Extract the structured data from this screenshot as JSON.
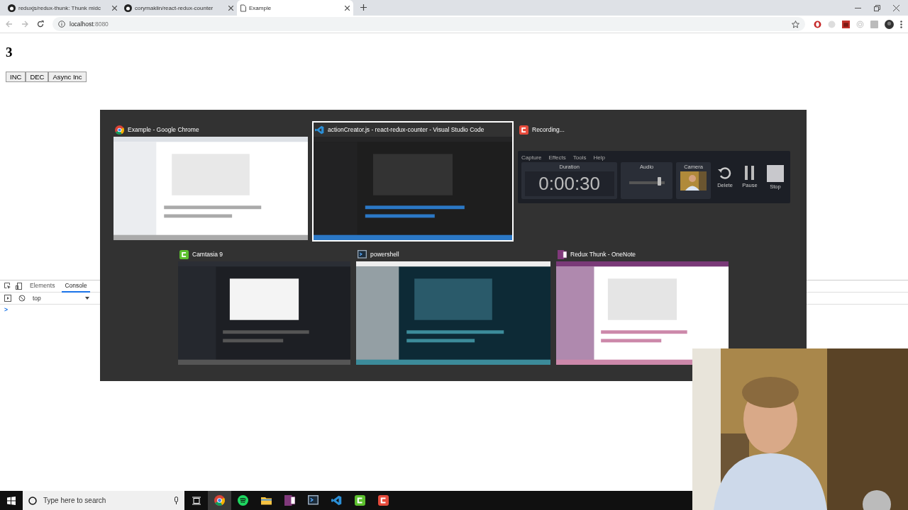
{
  "browser": {
    "tabs": [
      {
        "title": "reduxjs/redux-thunk: Thunk midc",
        "kind": "github",
        "selected": false
      },
      {
        "title": "corymaklin/react-redux-counter",
        "kind": "github",
        "selected": false
      },
      {
        "title": "Example",
        "kind": "page",
        "selected": true
      }
    ],
    "address": {
      "host": "localhost",
      "port": ":8080"
    }
  },
  "page": {
    "heading": "3",
    "buttons": [
      "INC",
      "DEC",
      "Async Inc"
    ]
  },
  "devtools": {
    "tabs": [
      {
        "label": "Elements",
        "selected": false
      },
      {
        "label": "Console",
        "selected": true
      }
    ],
    "context": "top",
    "prompt": ">"
  },
  "switcher": {
    "rows": [
      [
        {
          "title": "Example - Google Chrome",
          "kind": "chrome",
          "selected": false
        },
        {
          "title": "actionCreator.js - react-redux-counter - Visual Studio Code",
          "kind": "vscode",
          "selected": true
        },
        {
          "title": "Recording...",
          "kind": "recorder",
          "selected": false
        }
      ],
      [
        {
          "title": "Camtasia 9",
          "kind": "camtasia",
          "selected": false
        },
        {
          "title": "powershell",
          "kind": "powershell",
          "selected": false
        },
        {
          "title": "Redux Thunk - OneNote",
          "kind": "onenote",
          "selected": false
        }
      ]
    ],
    "recorder": {
      "menu": [
        "Capture",
        "Effects",
        "Tools",
        "Help"
      ],
      "duration_label": "Duration",
      "duration": "0:00:30",
      "audio_label": "Audio",
      "audio": {
        "level": 0.85
      },
      "camera_label": "Camera",
      "actions": [
        {
          "label": "Delete",
          "kind": "delete"
        },
        {
          "label": "Pause",
          "kind": "pause"
        },
        {
          "label": "Stop",
          "kind": "stop"
        }
      ]
    }
  },
  "taskbar": {
    "search": {
      "placeholder": "Type here to search"
    },
    "apps": [
      {
        "kind": "chrome",
        "selected": true
      },
      {
        "kind": "spotify",
        "selected": false
      },
      {
        "kind": "explorer",
        "selected": false
      },
      {
        "kind": "onenote",
        "selected": false
      },
      {
        "kind": "powershell",
        "selected": false
      },
      {
        "kind": "vscode",
        "selected": false
      },
      {
        "kind": "camtasia",
        "selected": false
      },
      {
        "kind": "recorder",
        "selected": false
      }
    ]
  }
}
